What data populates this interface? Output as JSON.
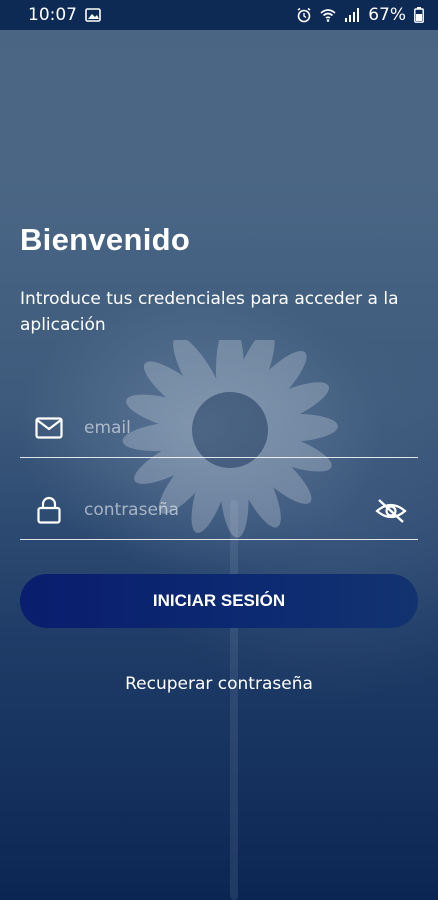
{
  "status_bar": {
    "time": "10:07",
    "battery": "67%"
  },
  "login": {
    "title": "Bienvenido",
    "subtitle": "Introduce tus credenciales para acceder a la aplicación",
    "email_placeholder": "email",
    "password_placeholder": "contraseña",
    "submit_label": "INICIAR SESIÓN",
    "recover_label": "Recuperar contraseña"
  },
  "icons": {
    "email": "mail-icon",
    "password": "lock-icon",
    "toggle_visibility": "eye-off-icon"
  },
  "colors": {
    "status_bar": "#0d2a55",
    "button": "#0a1d6e",
    "background_bottom": "#0c2654"
  }
}
